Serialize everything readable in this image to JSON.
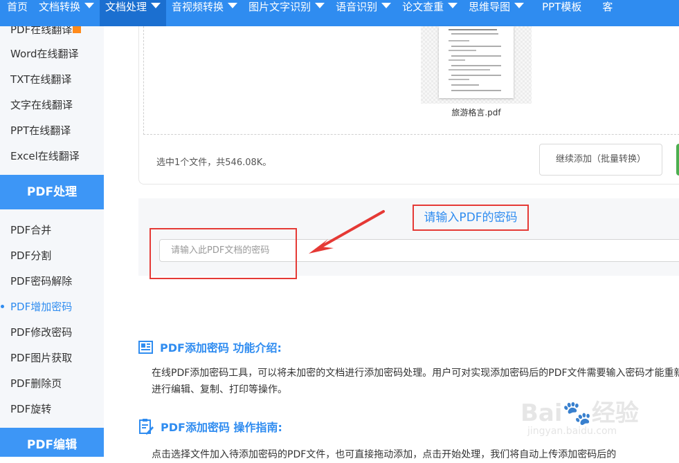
{
  "topnav": {
    "items": [
      {
        "label": "首页",
        "has_dropdown": false
      },
      {
        "label": "文档转换",
        "has_dropdown": true
      },
      {
        "label": "文档处理",
        "has_dropdown": true,
        "active": true
      },
      {
        "label": "音视频转换",
        "has_dropdown": true
      },
      {
        "label": "图片文字识别",
        "has_dropdown": true
      },
      {
        "label": "语音识别",
        "has_dropdown": true
      },
      {
        "label": "论文查重",
        "has_dropdown": true
      },
      {
        "label": "思维导图",
        "has_dropdown": true
      },
      {
        "label": "PPT模板",
        "has_dropdown": false
      },
      {
        "label": "客",
        "has_dropdown": false
      }
    ]
  },
  "sidebar": {
    "translate_items": [
      "PDF在线翻译",
      "Word在线翻译",
      "TXT在线翻译",
      "文字在线翻译",
      "PPT在线翻译",
      "Excel在线翻译"
    ],
    "pdf_process_header": "PDF处理",
    "pdf_process_items": [
      "PDF合并",
      "PDF分割",
      "PDF密码解除",
      "PDF增加密码",
      "PDF修改密码",
      "PDF图片获取",
      "PDF删除页",
      "PDF旋转"
    ],
    "active_item": "PDF增加密码",
    "pdf_edit_header": "PDF编辑"
  },
  "upload": {
    "file_name": "旅游格言.pdf",
    "summary": "选中1个文件，共546.08K。",
    "add_button": "继续添加（批量转换）"
  },
  "password": {
    "title": "请输入PDF的密码",
    "placeholder": "请输入此PDF文档的密码"
  },
  "intro": {
    "title": "PDF添加密码 功能介绍:",
    "body": "在线PDF添加密码工具，可以将未加密的文档进行添加密码处理。用户可对实现添加密码后的PDF文件需要输入密码才能重新进行编辑、复制、打印等操作。"
  },
  "guide": {
    "title": "PDF添加密码 操作指南:",
    "body": "点击选择文件加入待添加密码的PDF文件，也可直接拖动添加，点击开始处理，我们将自动上传添加密码后的"
  },
  "watermark": {
    "main": "Bai🐾经验",
    "sub": "jingyan.baidu.com"
  },
  "colors": {
    "brand_blue": "#2f8cf0",
    "nav_active": "#1b6fd0",
    "highlight_red": "#e53935",
    "start_green": "#4caf50"
  }
}
